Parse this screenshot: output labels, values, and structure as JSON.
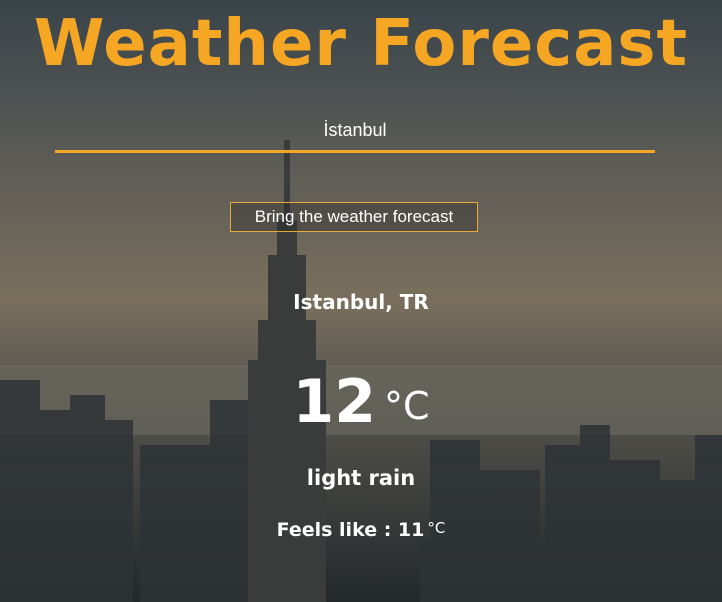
{
  "app": {
    "title": "Weather Forecast"
  },
  "search": {
    "value": "İstanbul"
  },
  "actions": {
    "fetch_label": "Bring the weather forecast"
  },
  "result": {
    "location": "Istanbul, TR",
    "temperature": "12",
    "temperature_unit": "°C",
    "description": "light rain",
    "feels_like_label": "Feels like : ",
    "feels_like_value": "11",
    "feels_like_unit": "°C"
  },
  "colors": {
    "accent": "#f5a623",
    "text": "#ffffff"
  }
}
